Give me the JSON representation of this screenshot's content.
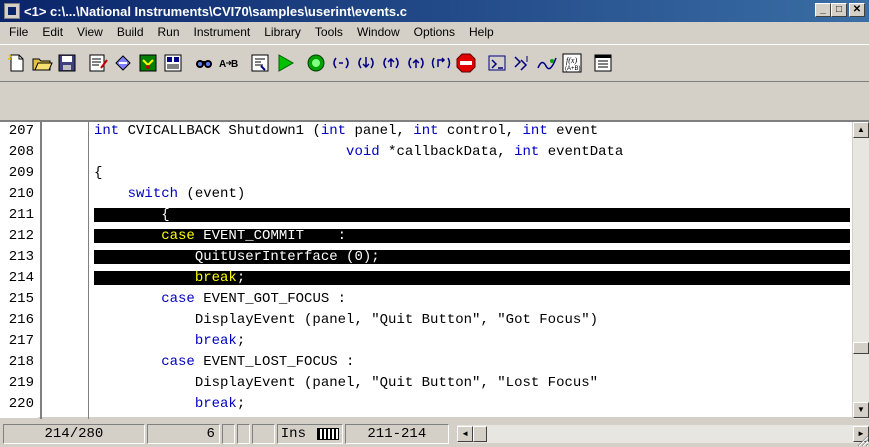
{
  "window": {
    "title": "<1> c:\\...\\National Instruments\\CVI70\\samples\\userint\\events.c",
    "minimize": "_",
    "maximize": "□",
    "close": "✕"
  },
  "menu": [
    "File",
    "Edit",
    "View",
    "Build",
    "Run",
    "Instrument",
    "Library",
    "Tools",
    "Window",
    "Options",
    "Help"
  ],
  "toolbar": {
    "icons": [
      "new-file-icon",
      "open-folder-icon",
      "save-icon",
      "edit-icon",
      "compile-icon",
      "debug-icon",
      "project-icon",
      "find-icon",
      "replace-icon",
      "build-icon",
      "run-icon",
      "breakpoint-icon",
      "step-over-icon",
      "step-into-icon",
      "step-out-icon",
      "go-icon",
      "finish-icon",
      "stop-icon",
      "watch-icon",
      "variables-icon",
      "trace-icon",
      "function-panel-icon",
      "window-icon"
    ]
  },
  "editor": {
    "lines": [
      {
        "num": "207",
        "text": [
          {
            "t": "int",
            "k": 1
          },
          {
            "t": " CVICALLBACK Shutdown1 (",
            "k": 0
          },
          {
            "t": "int",
            "k": 1
          },
          {
            "t": " panel, ",
            "k": 0
          },
          {
            "t": "int",
            "k": 1
          },
          {
            "t": " control, ",
            "k": 0
          },
          {
            "t": "int",
            "k": 1
          },
          {
            "t": " event",
            "k": 0
          }
        ]
      },
      {
        "num": "208",
        "text": [
          {
            "t": "                              ",
            "k": 0
          },
          {
            "t": "void",
            "k": 1
          },
          {
            "t": " *callbackData, ",
            "k": 0
          },
          {
            "t": "int",
            "k": 1
          },
          {
            "t": " eventData",
            "k": 0
          }
        ]
      },
      {
        "num": "209",
        "text": [
          {
            "t": "{",
            "k": 0
          }
        ]
      },
      {
        "num": "210",
        "text": [
          {
            "t": "    ",
            "k": 0
          },
          {
            "t": "switch",
            "k": 1
          },
          {
            "t": " (event)",
            "k": 0
          }
        ]
      },
      {
        "num": "211",
        "text": [
          {
            "t": "        {",
            "k": 0
          }
        ]
      },
      {
        "num": "212",
        "text": [
          {
            "t": "        ",
            "k": 0
          },
          {
            "t": "case",
            "k": 1
          },
          {
            "t": " EVENT_COMMIT    :",
            "k": 0
          }
        ]
      },
      {
        "num": "213",
        "text": [
          {
            "t": "            QuitUserInterface (0);",
            "k": 0
          }
        ]
      },
      {
        "num": "214",
        "text": [
          {
            "t": "            ",
            "k": 0
          },
          {
            "t": "break",
            "k": 1
          },
          {
            "t": ";",
            "k": 0
          }
        ]
      },
      {
        "num": "215",
        "text": [
          {
            "t": "        ",
            "k": 0
          },
          {
            "t": "case",
            "k": 1
          },
          {
            "t": " EVENT_GOT_FOCUS :",
            "k": 0
          }
        ]
      },
      {
        "num": "216",
        "text": [
          {
            "t": "            DisplayEvent (panel, \"Quit Button\", \"Got Focus\")",
            "k": 0
          }
        ]
      },
      {
        "num": "217",
        "text": [
          {
            "t": "            ",
            "k": 0
          },
          {
            "t": "break",
            "k": 1
          },
          {
            "t": ";",
            "k": 0
          }
        ]
      },
      {
        "num": "218",
        "text": [
          {
            "t": "        ",
            "k": 0
          },
          {
            "t": "case",
            "k": 1
          },
          {
            "t": " EVENT_LOST_FOCUS :",
            "k": 0
          }
        ]
      },
      {
        "num": "219",
        "text": [
          {
            "t": "            DisplayEvent (panel, \"Quit Button\", \"Lost Focus\"",
            "k": 0
          }
        ]
      },
      {
        "num": "220",
        "text": [
          {
            "t": "            ",
            "k": 0
          },
          {
            "t": "break",
            "k": 1
          },
          {
            "t": ";",
            "k": 0
          }
        ]
      }
    ],
    "selected_lines": [
      "211",
      "212",
      "213",
      "214"
    ]
  },
  "status": {
    "line_info": "214/280",
    "column": "6",
    "mode": "Ins",
    "selection": "211-214"
  },
  "colors": {
    "keyword": "#0000c0",
    "selection_bg": "#000000",
    "selection_keyword": "#ffff00"
  }
}
